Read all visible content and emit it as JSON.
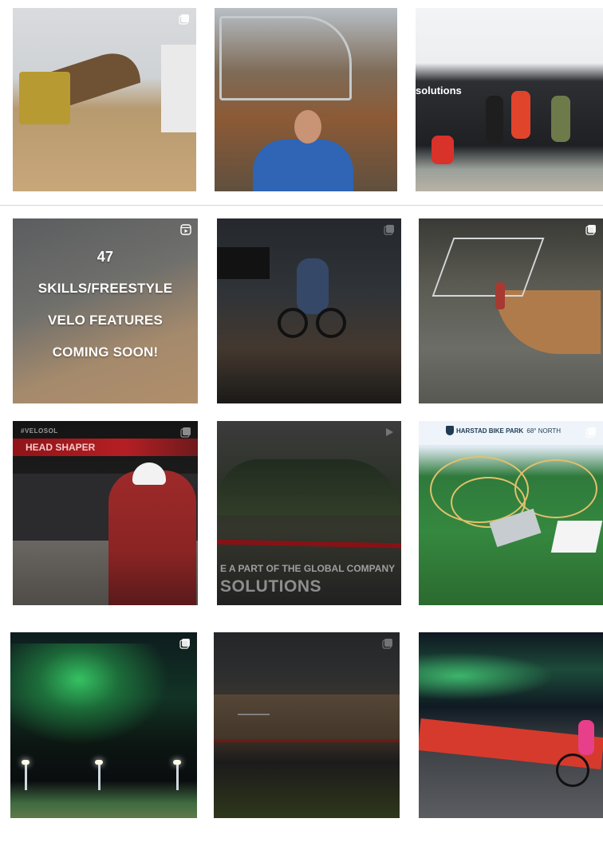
{
  "posts": [
    {
      "id": "p1",
      "kind": "album"
    },
    {
      "id": "p2",
      "kind": "photo"
    },
    {
      "id": "p3",
      "kind": "photo",
      "visible_text": "solutions"
    },
    {
      "id": "p4",
      "kind": "reel",
      "lines": [
        "47",
        "SKILLS/FREESTYLE",
        "VELO FEATURES",
        "COMING SOON!"
      ]
    },
    {
      "id": "p5",
      "kind": "album"
    },
    {
      "id": "p6",
      "kind": "album"
    },
    {
      "id": "p7",
      "kind": "album",
      "tag": "#VELOSOL",
      "headline": "HEAD SHAPER"
    },
    {
      "id": "p8",
      "kind": "reel",
      "line1": "E A PART OF THE GLOBAL COMPANY",
      "line2": "SOLUTIONS"
    },
    {
      "id": "p9",
      "kind": "album",
      "headline": "HARSTAD BIKE PARK",
      "sub": "68° NORTH"
    },
    {
      "id": "p10",
      "kind": "album"
    },
    {
      "id": "p11",
      "kind": "album"
    },
    {
      "id": "p12",
      "kind": "photo"
    }
  ],
  "colors": {
    "background": "#ffffff",
    "divider": "#d8d8d8",
    "brand_red": "#b51f24"
  },
  "icons": {
    "album": "carousel-icon",
    "reel": "reel-icon"
  }
}
